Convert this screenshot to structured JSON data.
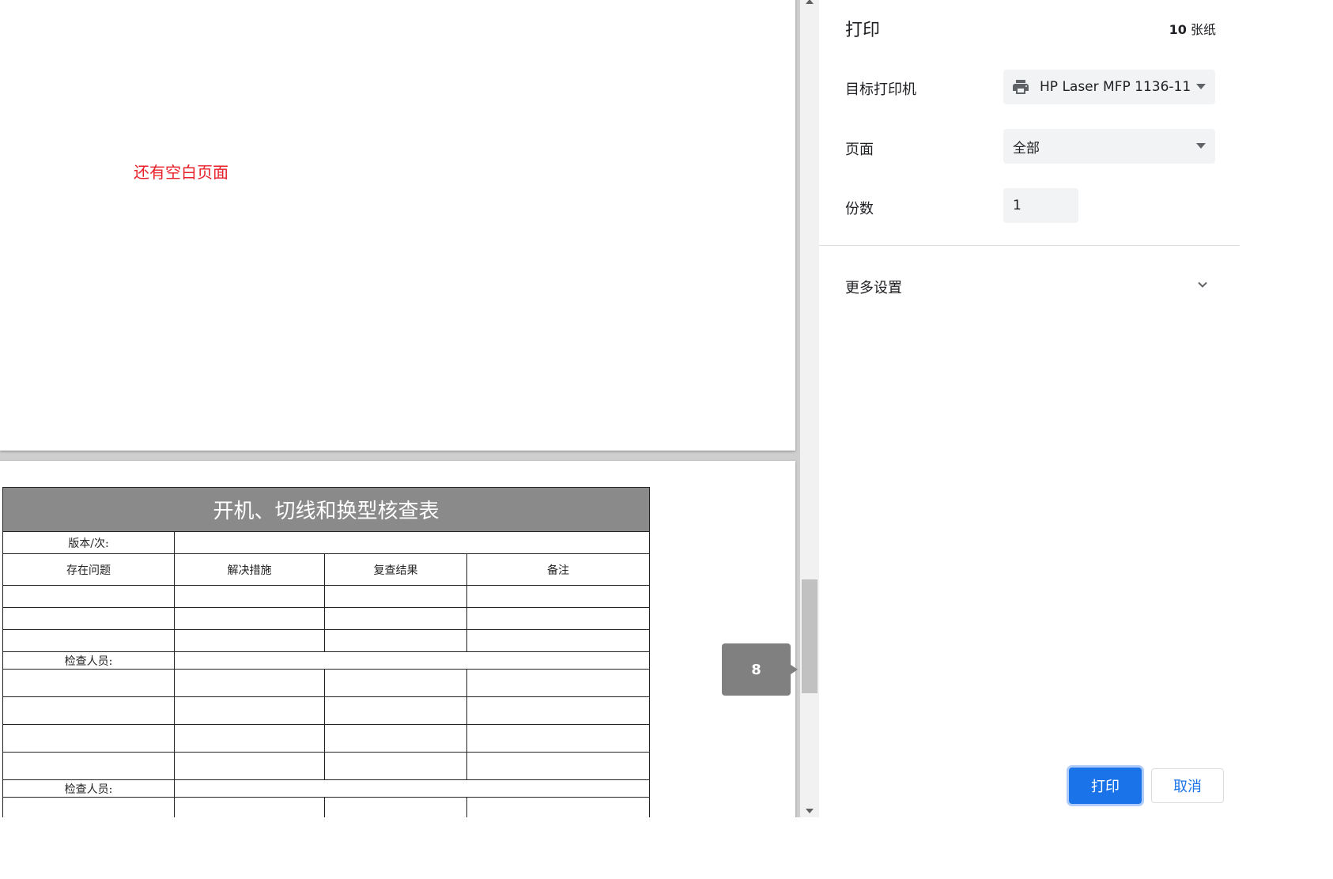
{
  "preview": {
    "blank_note": "还有空白页面",
    "page_indicator": "8",
    "table": {
      "title": "开机、切线和换型核查表",
      "version_label": "版本/次:",
      "headers": [
        "存在问题",
        "解决措施",
        "复查结果",
        "备注"
      ],
      "inspector_label": "检查人员:"
    }
  },
  "panel": {
    "title": "打印",
    "sheet_count_number": "10",
    "sheet_count_unit": "张纸",
    "destination_label": "目标打印机",
    "destination_value": "HP Laser MFP 1136-11",
    "pages_label": "页面",
    "pages_value": "全部",
    "copies_label": "份数",
    "copies_value": "1",
    "more_settings_label": "更多设置",
    "print_label": "打印",
    "cancel_label": "取消"
  },
  "colors": {
    "accent": "#1a73e8",
    "note_red": "#e8202a",
    "table_header_gray": "#8a8a8a"
  },
  "icons": [
    "printer-icon",
    "chevron-down-icon",
    "caret-down-icon",
    "scroll-up-arrow-icon",
    "scroll-down-arrow-icon"
  ]
}
